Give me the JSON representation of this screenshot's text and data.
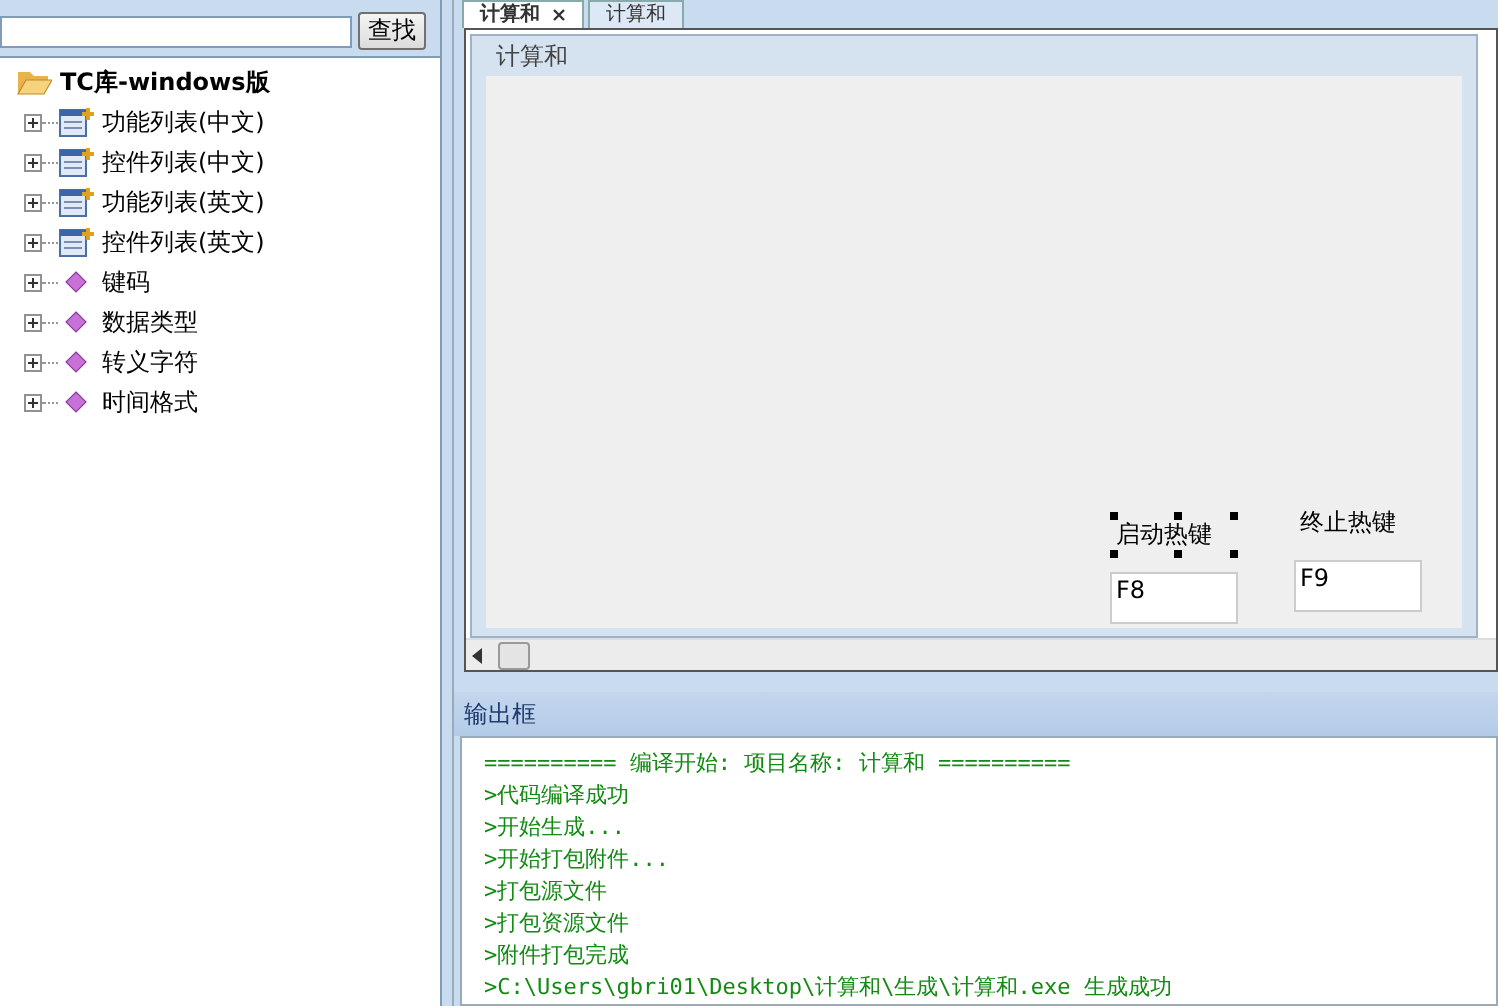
{
  "search": {
    "button": "查找"
  },
  "tree": {
    "label": "TC库-windows版",
    "expanded": true,
    "children": [
      {
        "label": "功能列表(中文)",
        "kind": "table",
        "expanded": false
      },
      {
        "label": "控件列表(中文)",
        "kind": "table",
        "expanded": false
      },
      {
        "label": "功能列表(英文)",
        "kind": "table",
        "expanded": false
      },
      {
        "label": "控件列表(英文)",
        "kind": "table",
        "expanded": false
      },
      {
        "label": "键码",
        "kind": "gem",
        "expanded": false
      },
      {
        "label": "数据类型",
        "kind": "gem",
        "expanded": false
      },
      {
        "label": "转义字符",
        "kind": "gem",
        "expanded": false
      },
      {
        "label": "时间格式",
        "kind": "gem",
        "expanded": false
      }
    ]
  },
  "tabs": [
    {
      "label": "计算和",
      "selected": true
    },
    {
      "label": "计算和",
      "selected": false
    }
  ],
  "form": {
    "title": "计算和",
    "controls": [
      {
        "label": "启动热键",
        "value": "F8",
        "selected": true
      },
      {
        "label": "终止热键",
        "value": "F9",
        "selected": false
      }
    ]
  },
  "output": {
    "title": "输出框",
    "lines": [
      "========== 编译开始: 项目名称: 计算和 ==========",
      ">代码编译成功",
      ">开始生成...",
      ">开始打包附件...",
      ">打包源文件",
      ">打包资源文件",
      ">附件打包完成",
      ">C:\\Users\\gbri01\\Desktop\\计算和\\生成\\计算和.exe 生成成功"
    ]
  }
}
